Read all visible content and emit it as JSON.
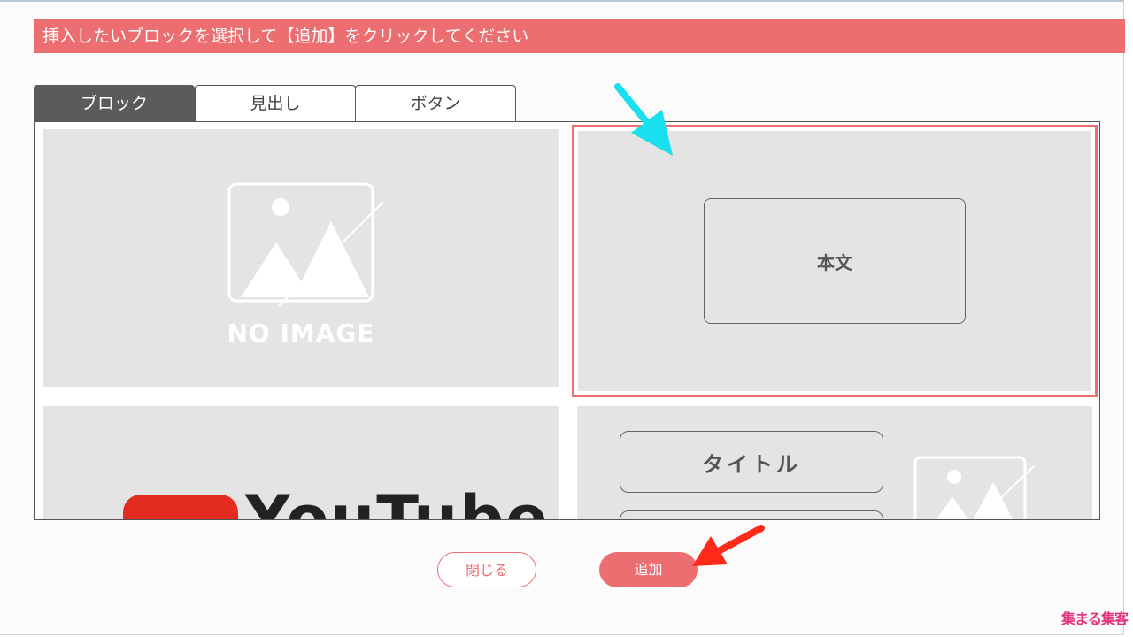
{
  "header": {
    "instruction": "挿入したいブロックを選択して【追加】をクリックしてください"
  },
  "tabs": [
    {
      "label": "ブロック",
      "active": true
    },
    {
      "label": "見出し",
      "active": false
    },
    {
      "label": "ボタン",
      "active": false
    }
  ],
  "blocks": {
    "no_image_label": "NO IMAGE",
    "body_text_label": "本文",
    "youtube_label": "YouTube",
    "title_label": "タイトル"
  },
  "footer": {
    "close_label": "閉じる",
    "add_label": "追加"
  },
  "logo": {
    "text": "集まる集客"
  },
  "colors": {
    "accent": "#ec6e71",
    "arrow_cyan": "#19e0ee",
    "arrow_red": "#ff2a1a",
    "tab_active": "#5b5b5b"
  }
}
